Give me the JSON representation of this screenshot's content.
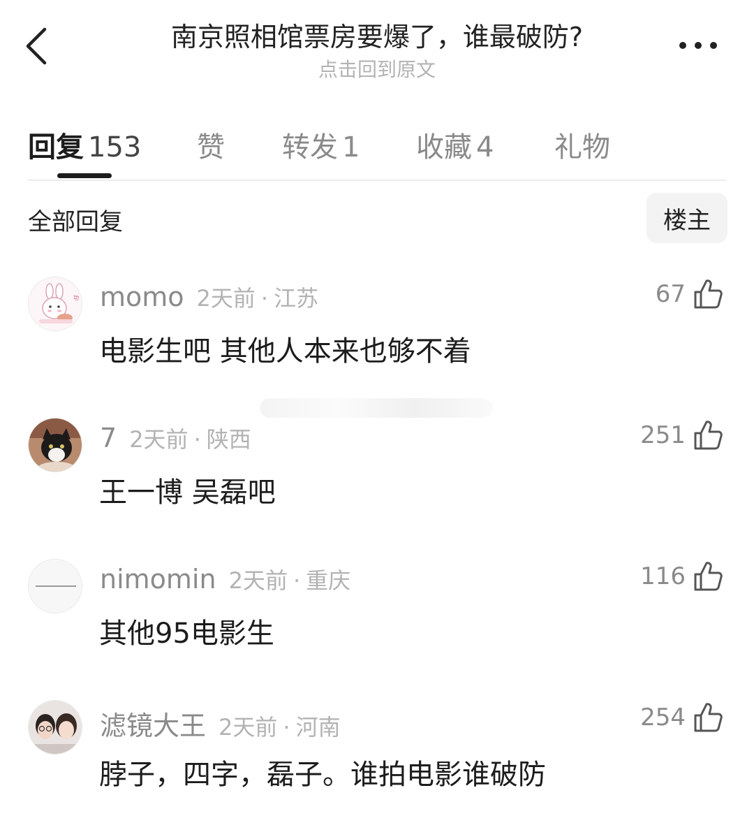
{
  "header": {
    "title": "南京照相馆票房要爆了，谁最破防?",
    "subtitle": "点击回到原文",
    "back_icon": "chevron-left-icon",
    "more_icon": "more-horizontal-icon"
  },
  "tabs": [
    {
      "label": "回复",
      "count": "153",
      "active": true
    },
    {
      "label": "赞",
      "count": ""
    },
    {
      "label": "转发",
      "count": "1"
    },
    {
      "label": "收藏",
      "count": "4"
    },
    {
      "label": "礼物",
      "count": ""
    }
  ],
  "section": {
    "title": "全部回复",
    "owner_button": "楼主"
  },
  "comments": [
    {
      "username": "momo",
      "time": "2天前",
      "location": "江苏",
      "text": "电影生吧 其他人本来也够不着",
      "likes": "67",
      "avatar_icon": "rabbit-cartoon-avatar"
    },
    {
      "username": "7",
      "time": "2天前",
      "location": "陕西",
      "text": "王一博 吴磊吧",
      "likes": "251",
      "avatar_icon": "cat-photo-avatar"
    },
    {
      "username": "nimomin",
      "time": "2天前",
      "location": "重庆",
      "text": "其他95电影生",
      "likes": "116",
      "avatar_icon": "text-quote-avatar"
    },
    {
      "username": "滤镜大王",
      "time": "2天前",
      "location": "河南",
      "text": "脖子，四字，磊子。谁拍电影谁破防",
      "likes": "254",
      "avatar_icon": "couple-photo-avatar"
    }
  ],
  "colors": {
    "primary_text": "#1c1c1c",
    "secondary_text": "#8a8a8a",
    "muted_text": "#b3b3b3"
  }
}
